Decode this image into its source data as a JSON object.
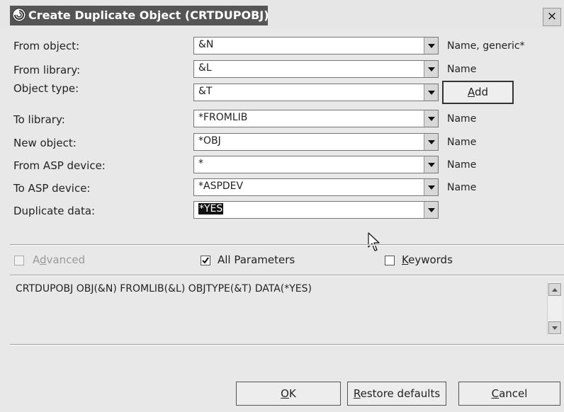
{
  "window": {
    "title": "Create Duplicate Object (CRTDUPOBJ)",
    "close_glyph": "×"
  },
  "fields": [
    {
      "label": "From object:",
      "value": "&N",
      "hint": "Name, generic*"
    },
    {
      "label": "From library:",
      "value": "&L",
      "hint": "Name"
    },
    {
      "label": "Object type:",
      "value": "&T",
      "hint": ""
    },
    {
      "label": "To library:",
      "value": "*FROMLIB",
      "hint": "Name"
    },
    {
      "label": "New object:",
      "value": "*OBJ",
      "hint": "Name"
    },
    {
      "label": "From ASP device:",
      "value": "*",
      "hint": "Name"
    },
    {
      "label": "To ASP device:",
      "value": "*ASPDEV",
      "hint": "Name"
    },
    {
      "label": "Duplicate data:",
      "value": "*YES",
      "hint": ""
    }
  ],
  "add_button": {
    "mnemonic": "A",
    "rest": "dd"
  },
  "options": {
    "advanced": {
      "pre": "A",
      "mnemonic": "d",
      "rest": "vanced",
      "checked": false,
      "enabled": false
    },
    "all_parameters": {
      "label": "All Parameters",
      "checked": true
    },
    "keywords": {
      "mnemonic": "K",
      "rest": "eywords",
      "checked": false
    }
  },
  "command": "CRTDUPOBJ OBJ(&N) FROMLIB(&L) OBJTYPE(&T) DATA(*YES)",
  "buttons": {
    "ok": {
      "mnemonic": "O",
      "rest": "K"
    },
    "restore": {
      "mnemonic": "R",
      "rest": "estore defaults"
    },
    "cancel": {
      "mnemonic": "C",
      "rest": "ancel"
    }
  },
  "icons": {
    "app": "ibm-spiral-icon",
    "dropdown": "chevron-down-icon",
    "cursor": "mouse-pointer-icon"
  },
  "colors": {
    "title_fill": "#555555",
    "dialog_bg": "#e8e8e8",
    "field_bg": "#ffffff",
    "selection": "#111111"
  }
}
